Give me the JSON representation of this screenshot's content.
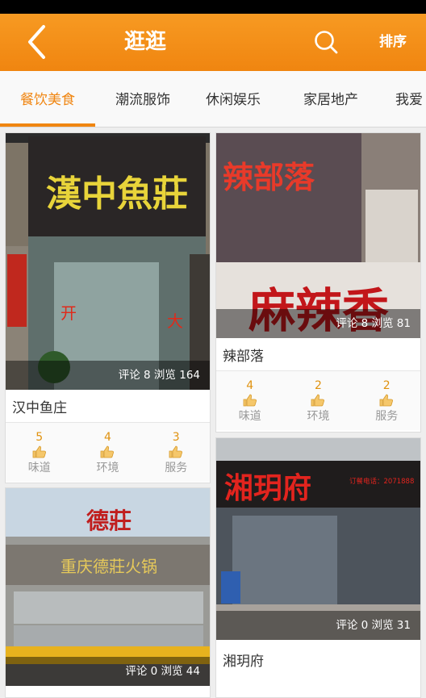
{
  "header": {
    "title": "逛逛",
    "sort_label": "排序",
    "accent_color": "#f08510"
  },
  "tabs": [
    {
      "label": "餐饮美食",
      "active": true
    },
    {
      "label": "潮流服饰",
      "active": false
    },
    {
      "label": "休闲娱乐",
      "active": false
    },
    {
      "label": "家居地产",
      "active": false
    },
    {
      "label": "我爱",
      "active": false
    }
  ],
  "shops": [
    {
      "name": "汉中鱼庄",
      "sign_text": "漢中魚莊",
      "stats": "评论 8 浏览 164",
      "ratings": [
        {
          "value": "5",
          "label": "味道"
        },
        {
          "value": "4",
          "label": "环境"
        },
        {
          "value": "3",
          "label": "服务"
        }
      ]
    },
    {
      "name": "辣部落",
      "sign_text": "辣部落",
      "sign_text_2": "麻辣香",
      "stats": "评论 8 浏览 81",
      "ratings": [
        {
          "value": "4",
          "label": "味道"
        },
        {
          "value": "2",
          "label": "环境"
        },
        {
          "value": "2",
          "label": "服务"
        }
      ]
    },
    {
      "name": "湘玥府",
      "sign_text": "湘玥府",
      "phone_text": "订餐电话：2071888",
      "stats": "评论 0 浏览 31"
    },
    {
      "name": "重庆德庄火锅",
      "sign_text": "德莊",
      "sign_text_2": "重庆德莊火锅",
      "stats": "评论 0 浏览 44"
    }
  ]
}
